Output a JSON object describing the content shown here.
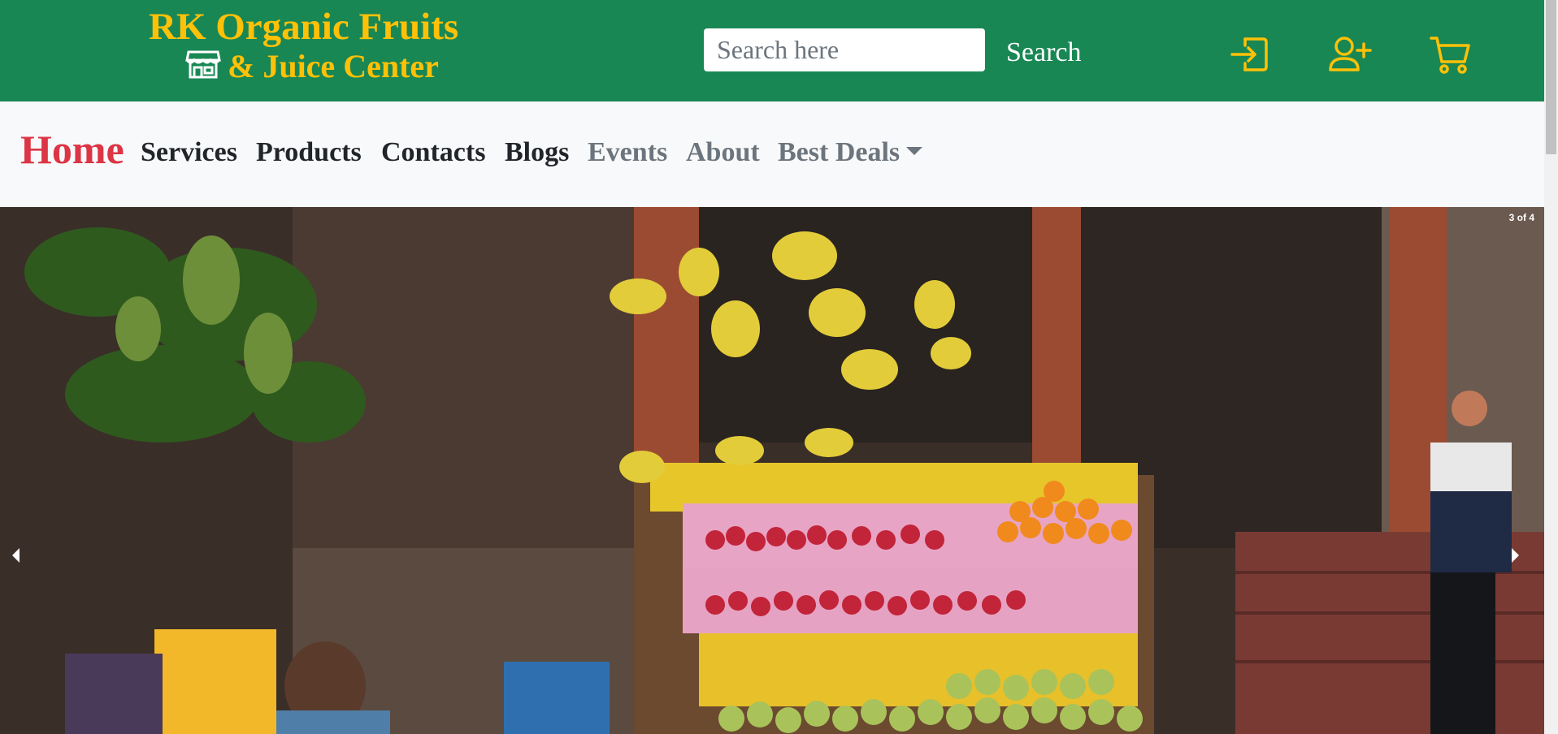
{
  "brand": {
    "line1": "RK Organic Fruits",
    "line2": "& Juice Center",
    "store_icon": "store-icon",
    "color": "#ffc107"
  },
  "search": {
    "placeholder": "Search here",
    "value": "",
    "button_label": "Search"
  },
  "header_icons": [
    "login-icon",
    "add-user-icon",
    "cart-icon"
  ],
  "nav": {
    "items": [
      {
        "label": "Home",
        "active": true
      },
      {
        "label": "Services"
      },
      {
        "label": "Products"
      },
      {
        "label": "Contacts"
      },
      {
        "label": "Blogs"
      },
      {
        "label": "Events"
      },
      {
        "label": "About"
      },
      {
        "label": "Best Deals",
        "dropdown": true
      }
    ]
  },
  "carousel": {
    "counter": "3 of 4",
    "image_alt": "Fruit stall with bananas, apples, oranges and mangoes"
  },
  "colors": {
    "header_bg": "#198754",
    "accent": "#ffc107",
    "active_nav": "#dc3545"
  }
}
